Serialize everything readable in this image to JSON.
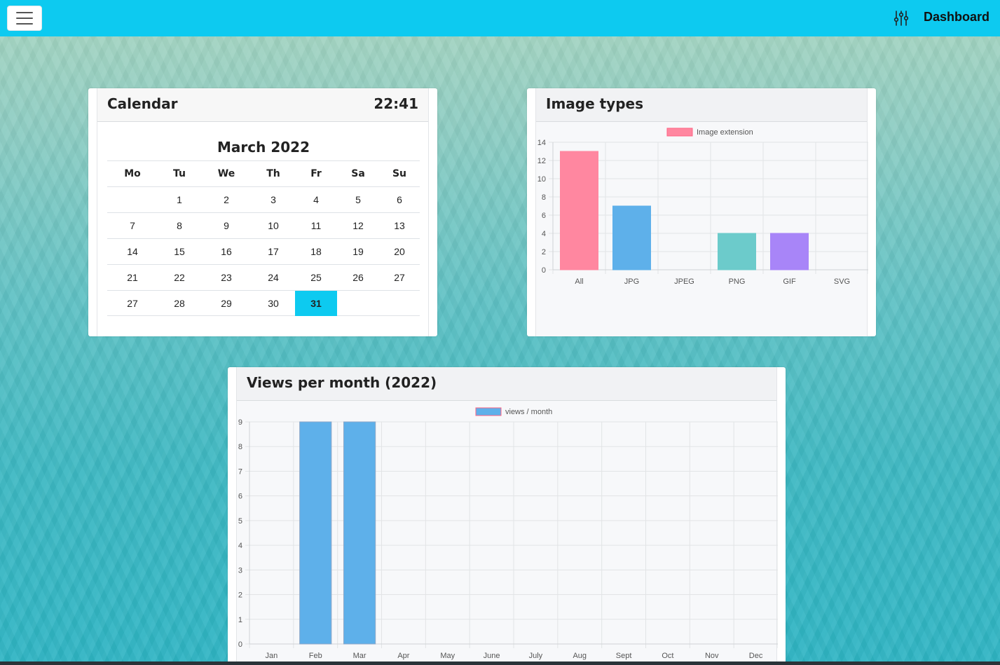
{
  "navbar": {
    "menu_icon": "hamburger-icon",
    "settings_icon": "sliders-icon",
    "brand": "Dashboard"
  },
  "calendar": {
    "title": "Calendar",
    "time": "22:41",
    "month": "March 2022",
    "weekdays": [
      "Mo",
      "Tu",
      "We",
      "Th",
      "Fr",
      "Sa",
      "Su"
    ],
    "weeks": [
      [
        "",
        "1",
        "2",
        "3",
        "4",
        "5",
        "6"
      ],
      [
        "7",
        "8",
        "9",
        "10",
        "11",
        "12",
        "13"
      ],
      [
        "14",
        "15",
        "16",
        "17",
        "18",
        "19",
        "20"
      ],
      [
        "21",
        "22",
        "23",
        "24",
        "25",
        "26",
        "27"
      ],
      [
        "27",
        "28",
        "29",
        "30",
        "31",
        "",
        ""
      ]
    ],
    "today": "31",
    "highlight_color": "#0dcaf0"
  },
  "image_types": {
    "title": "Image types"
  },
  "views": {
    "title": "Views per month (2022)"
  },
  "chart_data": [
    {
      "type": "bar",
      "title": "Image types",
      "categories": [
        "All",
        "JPG",
        "JPEG",
        "PNG",
        "GIF",
        "SVG"
      ],
      "series": [
        {
          "name": "Image extension",
          "values": [
            13,
            7,
            0,
            4,
            4,
            0
          ]
        }
      ],
      "colors": [
        "#ff87a0",
        "#5eb0ea",
        "#5eb0ea",
        "#6ccbcb",
        "#a885f8",
        "#ffce56"
      ],
      "ylim": [
        0,
        14
      ],
      "yticks": [
        0,
        2,
        4,
        6,
        8,
        10,
        12,
        14
      ],
      "legend": "top",
      "grid": true
    },
    {
      "type": "bar",
      "title": "Views per month (2022)",
      "categories": [
        "Jan",
        "Feb",
        "Mar",
        "Apr",
        "May",
        "June",
        "July",
        "Aug",
        "Sept",
        "Oct",
        "Nov",
        "Dec"
      ],
      "series": [
        {
          "name": "views / month",
          "values": [
            0,
            9,
            9,
            0,
            0,
            0,
            0,
            0,
            0,
            0,
            0,
            0
          ]
        }
      ],
      "colors": [
        "#5eb0ea"
      ],
      "ylim": [
        0,
        9
      ],
      "yticks": [
        0,
        1,
        2,
        3,
        4,
        5,
        6,
        7,
        8,
        9
      ],
      "legend": "top",
      "grid": true
    }
  ]
}
